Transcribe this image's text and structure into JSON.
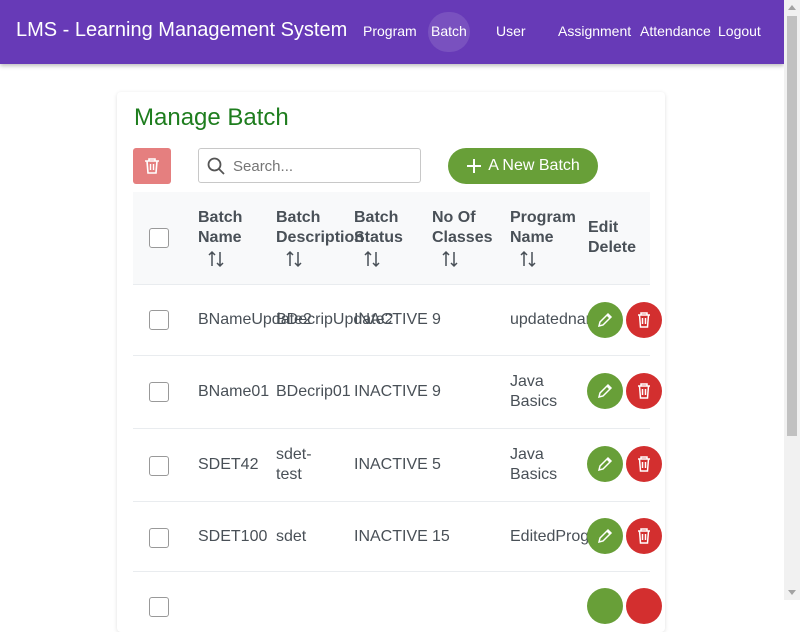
{
  "app": {
    "title": "LMS - Learning Management System"
  },
  "nav": {
    "program": "Program",
    "batch": "Batch",
    "user": "User",
    "assignment": "Assignment",
    "attendance": "Attendance",
    "logout": "Logout"
  },
  "page": {
    "title": "Manage Batch",
    "search_placeholder": "Search...",
    "new_batch_label": "A New Batch"
  },
  "table": {
    "headers": {
      "name_1": "Batch",
      "name_2": "Name",
      "desc_1": "Batch",
      "desc_2": "Description",
      "status_1": "Batch",
      "status_2": "Status",
      "classes_1": "No Of",
      "classes_2": "Classes",
      "program_1": "Program",
      "program_2": "Name",
      "actions_1": "Edit",
      "actions_2": "Delete"
    },
    "rows": [
      {
        "name": "BNameUpdate2",
        "desc": "BDecripUpdate2",
        "status": "INACTIVE",
        "classes": "9",
        "program_1": "updatedname",
        "program_2": ""
      },
      {
        "name": "BName01",
        "desc": "BDecrip01",
        "status": "INACTIVE",
        "classes": "9",
        "program_1": "Java",
        "program_2": "Basics"
      },
      {
        "name": "SDET42",
        "desc_1": "sdet-",
        "desc_2": "test",
        "status": "INACTIVE",
        "classes": "5",
        "program_1": "Java",
        "program_2": "Basics"
      },
      {
        "name": "SDET100",
        "desc": "sdet",
        "status": "INACTIVE",
        "classes": "15",
        "program_1": "EditedProgram",
        "program_2": ""
      }
    ]
  },
  "colors": {
    "nav_bg": "#673ab7",
    "title_green": "#1e7d1e",
    "edit_green": "#689f38",
    "delete_red": "#d32f2f",
    "delete_all_pink": "#e57f7f"
  },
  "icons": {
    "delete_all": "trash-icon",
    "search": "search-icon",
    "new_batch": "plus-icon",
    "sort": "sort-icon",
    "edit": "pencil-icon",
    "delete": "trash-icon"
  }
}
